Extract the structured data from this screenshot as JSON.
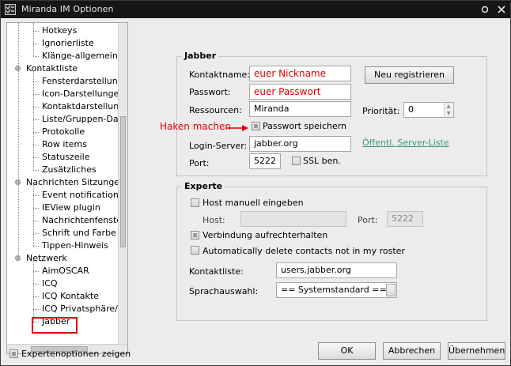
{
  "window": {
    "title": "Miranda IM Optionen"
  },
  "tree": {
    "items": [
      {
        "label": "Hotkeys",
        "level": 1
      },
      {
        "label": "Ignorierliste",
        "level": 1
      },
      {
        "label": "Klänge-allgemein",
        "level": 1
      },
      {
        "label": "Kontaktliste",
        "level": 0
      },
      {
        "label": "Fensterdarstellung",
        "level": 1
      },
      {
        "label": "Icon-Darstellungen",
        "level": 1
      },
      {
        "label": "Kontaktdarstellung",
        "level": 1
      },
      {
        "label": "Liste/Gruppen-Darst",
        "level": 1
      },
      {
        "label": "Protokolle",
        "level": 1
      },
      {
        "label": "Row items",
        "level": 1
      },
      {
        "label": "Statuszeile",
        "level": 1
      },
      {
        "label": "Zusätzliches",
        "level": 1
      },
      {
        "label": "Nachrichten Sitzungen",
        "level": 0
      },
      {
        "label": "Event notifications",
        "level": 1
      },
      {
        "label": "IEView plugin",
        "level": 1
      },
      {
        "label": "Nachrichtenfenster",
        "level": 1
      },
      {
        "label": "Schrift und Farbe",
        "level": 1
      },
      {
        "label": "Tippen-Hinweis",
        "level": 1
      },
      {
        "label": "Netzwerk",
        "level": 0
      },
      {
        "label": "AimOSCAR",
        "level": 1
      },
      {
        "label": "ICQ",
        "level": 1
      },
      {
        "label": "ICQ Kontakte",
        "level": 1
      },
      {
        "label": "ICQ Privatsphäre/Ar",
        "level": 1
      },
      {
        "label": "Jabber",
        "level": 1
      }
    ],
    "selected": "Jabber"
  },
  "jabber": {
    "title": "Jabber",
    "contact_label": "Kontaktname:",
    "contact_value": "euer Nickname",
    "password_label": "Passwort:",
    "password_value": "euer Passwort",
    "resource_label": "Ressourcen:",
    "resource_value": "Miranda",
    "priority_label": "Priorität:",
    "priority_value": "0",
    "register_button": "Neu registrieren",
    "save_password_label": "Passwort speichern",
    "save_password_checked": true,
    "server_label": "Login-Server:",
    "server_value": "jabber.org",
    "server_list_link": "Öffentl. Server-Liste",
    "port_label": "Port:",
    "port_value": "5222",
    "ssl_label": "SSL ben.",
    "ssl_checked": false
  },
  "annotation": {
    "text": "Haken machen",
    "color": "#e00000"
  },
  "expert": {
    "title": "Experte",
    "manual_host_label": "Host manuell eingeben",
    "manual_host_checked": false,
    "host_label": "Host:",
    "host_value": "",
    "port_label": "Port:",
    "port_value": "5222",
    "keep_alive_label": "Verbindung aufrechterhalten",
    "keep_alive_checked": true,
    "auto_delete_label": "Automatically delete contacts not in my roster",
    "auto_delete_checked": false,
    "contact_list_label": "Kontaktliste:",
    "contact_list_value": "users.jabber.org",
    "language_label": "Sprachauswahl:",
    "language_value": "== Systemstandard =="
  },
  "footer": {
    "expert_options_label": "Expertenoptionen zeigen",
    "expert_options_checked": true,
    "ok_button": "OK",
    "cancel_button": "Abbrechen",
    "apply_button": "Übernehmen"
  },
  "colors": {
    "titlebar": "#161616",
    "dialog": "#ececec",
    "annotation": "#e00000",
    "link": "#3a9a7a"
  }
}
